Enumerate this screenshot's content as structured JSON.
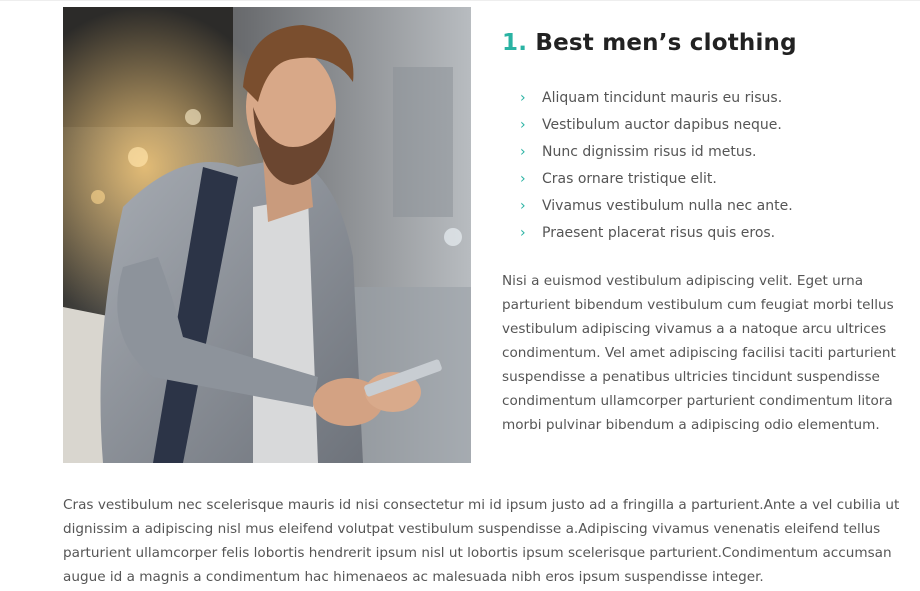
{
  "product": {
    "number": "1.",
    "title": "Best men’s clothing"
  },
  "features": [
    "Aliquam tincidunt mauris eu risus.",
    "Vestibulum auctor dapibus neque.",
    "Nunc dignissim risus id metus.",
    "Cras ornare tristique elit.",
    "Vivamus vestibulum nulla nec ante.",
    "Praesent placerat risus quis eros."
  ],
  "bullet_icon": "chevron-right-icon",
  "paragraph": "Nisi a euismod vestibulum adipiscing velit. Eget urna parturient bibendum vestibulum cum feugiat morbi tellus vestibulum adipiscing vivamus a a natoque arcu ultrices condimentum. Vel amet adipiscing facilisi taciti parturient suspendisse a penatibus ultricies tincidunt suspendisse condimentum ullamcorper parturient condimentum litora morbi pulvinar bibendum a adipiscing odio elementum.",
  "bottom_text": "Cras vestibulum nec scelerisque mauris id nisi consectetur mi id ipsum justo ad a fringilla a parturient.Ante a vel cubilia ut dignissim a adipiscing nisl mus eleifend volutpat vestibulum suspendisse a.Adipiscing vivamus venenatis eleifend tellus parturient ullamcorper felis lobortis hendrerit ipsum nisl ut lobortis ipsum scelerisque parturient.Condimentum accumsan augue id a magnis a condimentum hac himenaeos ac malesuada nibh eros ipsum suspendisse integer.",
  "colors": {
    "accent": "#2ab3a3",
    "heading": "#222222",
    "body_text": "#555555"
  }
}
